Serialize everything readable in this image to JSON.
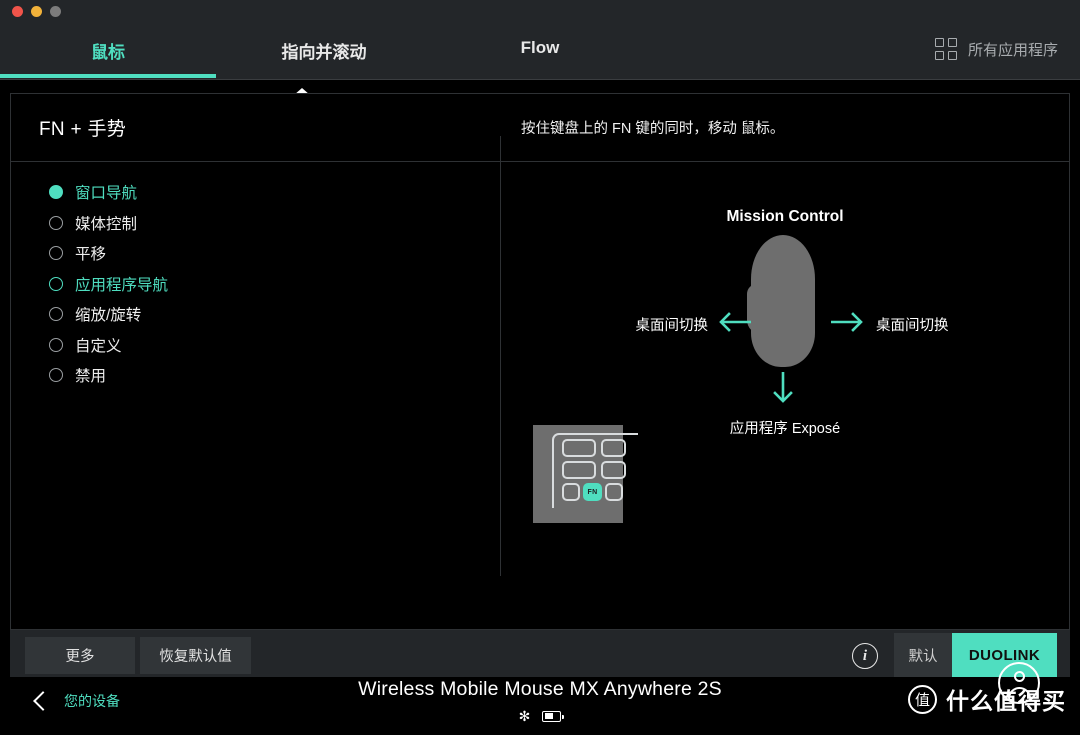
{
  "window": {
    "traffic_lights": [
      "close",
      "minimize",
      "zoom"
    ]
  },
  "tabs": [
    {
      "label": "鼠标",
      "active": true
    },
    {
      "label": "指向并滚动",
      "active": false
    },
    {
      "label": "Flow",
      "active": false
    }
  ],
  "all_apps": {
    "label": "所有应用程序",
    "icon": "grid-icon"
  },
  "panel": {
    "title": "FN + 手势",
    "description": "按住键盘上的 FN 键的同时，移动 鼠标。"
  },
  "options": [
    {
      "label": "窗口导航",
      "state": "selected"
    },
    {
      "label": "媒体控制",
      "state": "normal"
    },
    {
      "label": "平移",
      "state": "normal"
    },
    {
      "label": "应用程序导航",
      "state": "hover"
    },
    {
      "label": "缩放/旋转",
      "state": "normal"
    },
    {
      "label": "自定义",
      "state": "normal"
    },
    {
      "label": "禁用",
      "state": "normal"
    }
  ],
  "diagram": {
    "up_label": "Mission Control",
    "down_label": "应用程序 Exposé",
    "left_label": "桌面间切换",
    "right_label": "桌面间切换",
    "keyboard_key": "FN"
  },
  "actions": {
    "more_label": "更多",
    "reset_label": "恢复默认值",
    "info_glyph": "i",
    "segments": [
      {
        "label": "默认",
        "active": false
      },
      {
        "label": "DUOLINK",
        "active": true
      }
    ]
  },
  "footer": {
    "back_label": "您的设备",
    "device_name": "Wireless Mobile Mouse MX Anywhere 2S",
    "bluetooth_glyph": "✻",
    "watermark_badge": "值",
    "watermark_text": "什么值得买"
  },
  "colors": {
    "accent": "#4FDEC0",
    "panel_bg": "#000000",
    "chrome_bg": "#232629",
    "button_bg": "#313538",
    "mouse_gray": "#6E6E6E"
  }
}
